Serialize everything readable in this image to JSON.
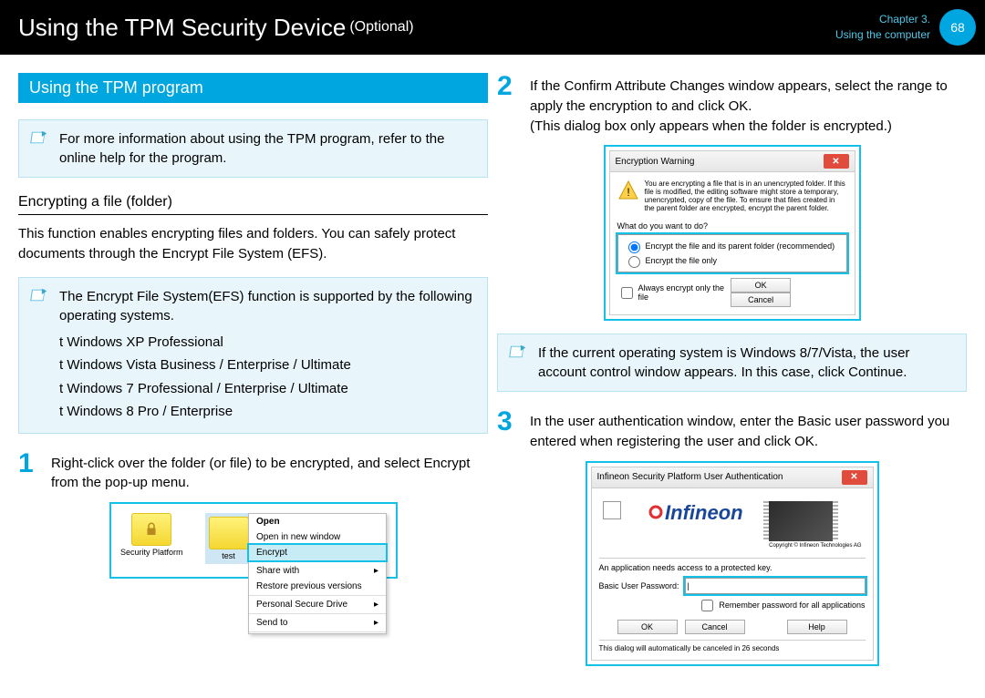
{
  "header": {
    "title": "Using the TPM Security Device",
    "subtitle": "(Optional)",
    "chapter_line1": "Chapter 3.",
    "chapter_line2": "Using the computer",
    "page_number": "68"
  },
  "section": {
    "title": "Using the TPM program"
  },
  "info1": "For more information about using the TPM program, refer to the online help for the program.",
  "subheading": "Encrypting a ﬁle (folder)",
  "body1": "This function enables encrypting ﬁles and folders. You can safely protect documents through the Encrypt File System (EFS).",
  "info2": {
    "lead": "The Encrypt File System(EFS) function is supported by the following operating systems.",
    "os": [
      "t Windows XP Professional",
      "t Windows Vista Business / Enterprise / Ultimate",
      "t Windows 7 Professional / Enterprise / Ultimate",
      "t Windows 8 Pro / Enterprise"
    ]
  },
  "step1": {
    "num": "1",
    "text": "Right-click over the folder (or ﬁle) to be encrypted, and select Encrypt from the pop-up menu."
  },
  "ctx": {
    "folders": [
      "Security Platform",
      "test",
      ""
    ],
    "menu": {
      "open": "Open",
      "open_new": "Open in new window",
      "encrypt": "Encrypt",
      "share": "Share with",
      "restore": "Restore previous versions",
      "psd": "Personal Secure Drive",
      "send": "Send to"
    }
  },
  "step2": {
    "num": "2",
    "text1": "If the Conﬁrm Attribute Changes window appears, select the range to apply the encryption to and click OK.",
    "text2": "(This dialog box only appears when the folder is encrypted.)"
  },
  "warn_dlg": {
    "title": "Encryption Warning",
    "msg": "You are encrypting a file that is in an unencrypted folder. If this file is modified, the editing software might store a temporary, unencrypted, copy of the file. To ensure that files created in the parent folder are encrypted, encrypt the parent folder.",
    "question": "What do you want to do?",
    "r1": "Encrypt the file and its parent folder (recommended)",
    "r2": "Encrypt the file only",
    "always": "Always encrypt only the file",
    "ok": "OK",
    "cancel": "Cancel"
  },
  "info3": "If the current operating system is Windows 8/7/Vista, the user account control window appears. In this case, click Continue.",
  "step3": {
    "num": "3",
    "text": "In the user authentication window, enter the Basic user password you entered when registering the user and click OK."
  },
  "auth_dlg": {
    "title": "Infineon Security Platform User Authentication",
    "logo_text": "Infineon",
    "copyright": "Copyright © Infineon Technologies AG",
    "line1": "An application needs access to a protected key.",
    "pw_label": "Basic User Password:",
    "pw_value": "|",
    "remember": "Remember password for all applications",
    "ok": "OK",
    "cancel": "Cancel",
    "help": "Help",
    "footer": "This dialog will automatically be canceled in 26 seconds"
  }
}
